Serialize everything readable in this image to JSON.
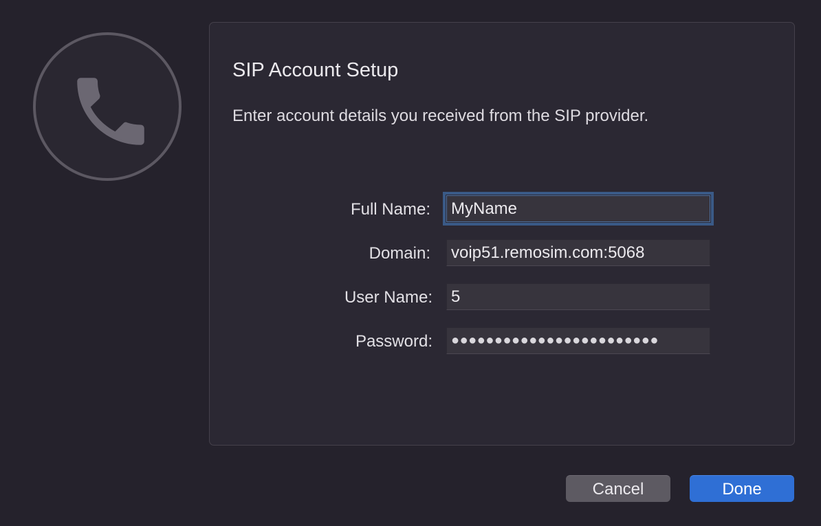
{
  "dialog": {
    "title": "SIP Account Setup",
    "subtitle": "Enter account details you received from the SIP provider."
  },
  "icon": {
    "name": "phone-icon"
  },
  "form": {
    "full_name": {
      "label": "Full Name:",
      "value": "MyName"
    },
    "domain": {
      "label": "Domain:",
      "value": "voip51.remosim.com:5068"
    },
    "user_name": {
      "label": "User Name:",
      "value": "5"
    },
    "password": {
      "label": "Password:",
      "value": "●●●●●●●●●●●●●●●●●●●●●●●●"
    }
  },
  "buttons": {
    "cancel": "Cancel",
    "done": "Done"
  },
  "colors": {
    "background": "#25222c",
    "panel": "#2b2833",
    "accent": "#2f6fd5",
    "focus_ring": "#3a5a87"
  }
}
